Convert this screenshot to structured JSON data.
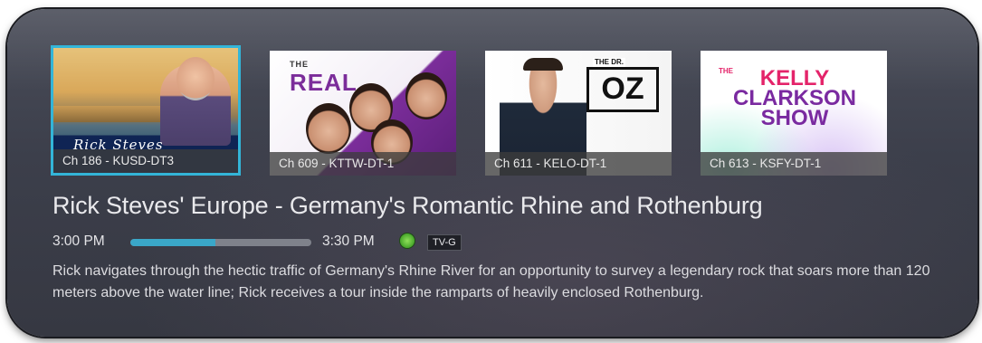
{
  "channels": [
    {
      "caption": "Ch 186 - KUSD-DT3",
      "art": "Rick Steves",
      "selected": true
    },
    {
      "caption": "Ch 609 - KTTW-DT-1",
      "art": "THE REAL",
      "selected": false
    },
    {
      "caption": "Ch 611 - KELO-DT-1",
      "art": "THE DR. OZ SHOW",
      "selected": false
    },
    {
      "caption": "Ch 613 - KSFY-DT-1",
      "art": "THE KELLY CLARKSON SHOW",
      "selected": false
    }
  ],
  "program": {
    "title": "Rick Steves' Europe - Germany's Romantic Rhine and Rothenburg",
    "start_time": "3:00 PM",
    "end_time": "3:30 PM",
    "progress": 0.47,
    "rating": "TV-G",
    "description": "Rick navigates through the hectic traffic of Germany's Rhine River for an opportunity to survey a legendary rock that soars more than 120 meters above the water line; Rick receives a tour inside the ramparts of heavily enclosed Rothenburg."
  },
  "art_text": {
    "rick_script": "Rick Steves",
    "real_the": "THE",
    "real_word": "REAL",
    "oz_the": "THE DR.",
    "oz_word": "OZ",
    "kelly_the": "THE",
    "kelly_line1": "KELLY",
    "kelly_line2": "CLARKSON",
    "kelly_line3": "SHOW"
  },
  "colors": {
    "accent": "#33b5d8",
    "progress_fill": "#3aa7c8",
    "panel": "#3c3f4b"
  },
  "icons": {
    "hd": "green-circle-icon"
  }
}
